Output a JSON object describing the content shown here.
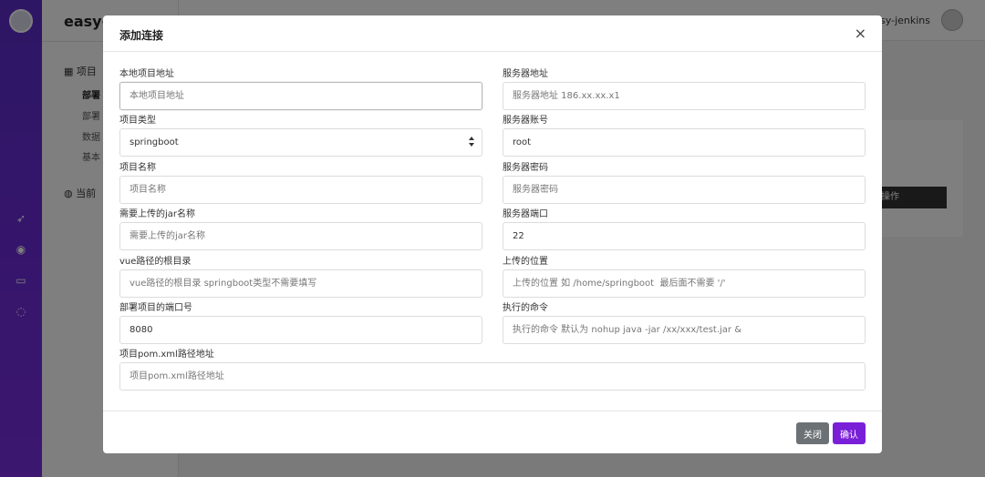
{
  "app": {
    "brand": "easy-je",
    "user": "easy-jenkins",
    "sidebar": {
      "section1": "项目",
      "items": [
        "部署",
        "部署",
        "数据",
        "基本"
      ],
      "section2": "当前"
    },
    "card_action": "操作"
  },
  "modal": {
    "title": "添加连接",
    "close_icon": "×",
    "fields": {
      "local_path": {
        "label": "本地项目地址",
        "placeholder": "本地项目地址"
      },
      "server_addr": {
        "label": "服务器地址",
        "placeholder": "服务器地址 186.xx.xx.x1"
      },
      "project_type": {
        "label": "项目类型",
        "value": "springboot"
      },
      "server_account": {
        "label": "服务器账号",
        "value": "root"
      },
      "project_name": {
        "label": "项目名称",
        "placeholder": "项目名称"
      },
      "server_password": {
        "label": "服务器密码",
        "placeholder": "服务器密码"
      },
      "jar_name": {
        "label": "需要上传的jar名称",
        "placeholder": "需要上传的jar名称"
      },
      "server_port": {
        "label": "服务器端口",
        "value": "22"
      },
      "vue_root": {
        "label": "vue路径的根目录",
        "placeholder": "vue路径的根目录 springboot类型不需要填写"
      },
      "upload_location": {
        "label": "上传的位置",
        "placeholder": "上传的位置 如 /home/springboot  最后面不需要 '/'"
      },
      "deploy_port": {
        "label": "部署项目的端口号",
        "value": "8080"
      },
      "command": {
        "label": "执行的命令",
        "placeholder": "执行的命令 默认为 nohup java -jar /xx/xxx/test.jar &"
      },
      "pom_path": {
        "label": "项目pom.xml路径地址",
        "placeholder": "项目pom.xml路径地址"
      }
    },
    "buttons": {
      "close": "关闭",
      "confirm": "确认"
    }
  },
  "colors": {
    "accent": "#7a1fd8",
    "secondary": "#6b7175",
    "rail": "#6a2bd6"
  },
  "icons": [
    "grid-icon",
    "globe-icon",
    "rocket-icon",
    "compass-icon",
    "inbox-icon",
    "chat-icon",
    "close-icon",
    "select-arrows-icon"
  ]
}
